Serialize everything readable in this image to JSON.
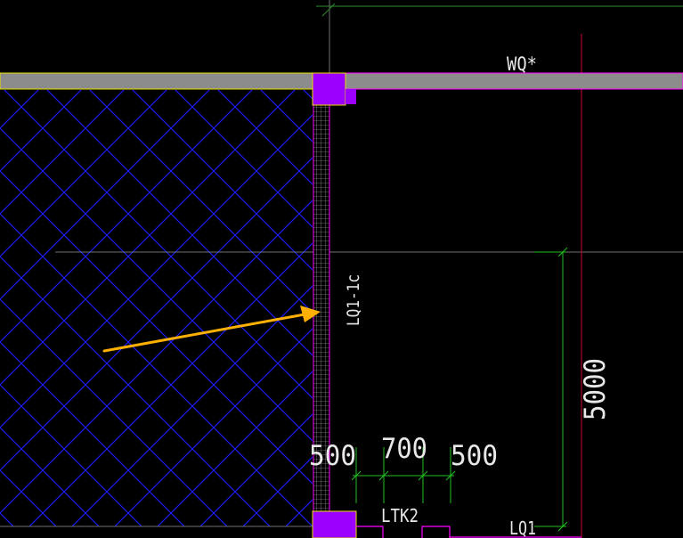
{
  "drawing": {
    "colors": {
      "background": "#000000",
      "wall_fill": "#8c8c8c",
      "wall_edge_yellow": "#e8e000",
      "wall_edge_magenta": "#ff00ff",
      "column_fill": "#9b00ff",
      "hatch": "#1a1aff",
      "grid_line": "#6f6f6f",
      "axis_red": "#b0002a",
      "dimension": "#22c022",
      "label": "#e8e8e8",
      "arrow": "#ffb000",
      "wall_strip": "#bdbdbd"
    },
    "labels": {
      "top_wall": "WQ*",
      "vertical_wall": "LQ1-1c",
      "bottom_opening": "LTK2",
      "bottom_wall": "LQ1"
    },
    "dimensions": {
      "vertical": "5000",
      "horizontal": [
        "500",
        "700",
        "500"
      ]
    }
  }
}
